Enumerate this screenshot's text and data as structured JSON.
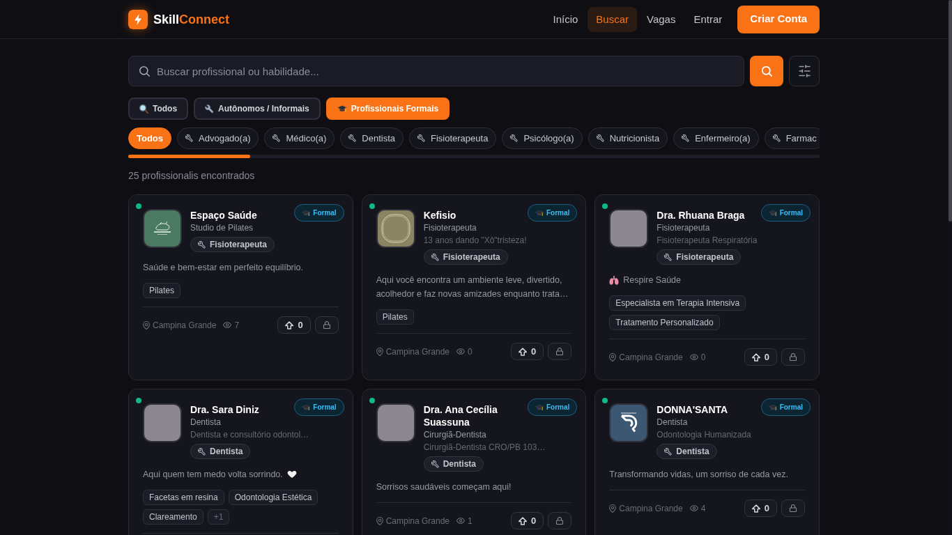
{
  "header": {
    "logo": {
      "text": "Skill",
      "accent": "Connect"
    },
    "nav": [
      {
        "label": "Início",
        "selected": false
      },
      {
        "label": "Buscar",
        "selected": true
      },
      {
        "label": "Vagas",
        "selected": false
      },
      {
        "label": "Entrar",
        "selected": false
      }
    ],
    "cta": "Criar Conta"
  },
  "search": {
    "placeholder": "Buscar profissional ou habilidade..."
  },
  "type_tabs": [
    {
      "kind": "all",
      "label": "Todos",
      "selected": false
    },
    {
      "kind": "informal",
      "label": "Autônomos / Informais",
      "selected": false
    },
    {
      "kind": "formal",
      "label": "Profissionais Formais",
      "selected": true
    }
  ],
  "category_chips": [
    {
      "kind": "all",
      "label": "Todos",
      "selected": true
    },
    {
      "kind": "category",
      "label": "Advogado(a)",
      "selected": false
    },
    {
      "kind": "category",
      "label": "Médico(a)",
      "selected": false
    },
    {
      "kind": "category",
      "label": "Dentista",
      "selected": false
    },
    {
      "kind": "category",
      "label": "Fisioterapeuta",
      "selected": false
    },
    {
      "kind": "category",
      "label": "Psicólogo(a)",
      "selected": false
    },
    {
      "kind": "category",
      "label": "Nutricionista",
      "selected": false
    },
    {
      "kind": "category",
      "label": "Enfermeiro(a)",
      "selected": false
    },
    {
      "kind": "category",
      "label": "Farmac",
      "selected": false
    }
  ],
  "results_count": "25 profissionalis encontrados",
  "cards": [
    {
      "online": true,
      "avatar": {
        "kind": "sketch"
      },
      "badge": "Formal",
      "name": "Espaço Saúde",
      "lines": [
        "Studio de Pilates"
      ],
      "category": "Fisioterapeuta",
      "description": {
        "kind": "plain",
        "text": "Saúde e bem-estar em perfeito equilíbrio."
      },
      "tags": [
        "Pilates"
      ],
      "footer": {
        "location": "Campina Grande",
        "views": "7",
        "votes": "0"
      }
    },
    {
      "online": true,
      "avatar": {
        "kind": "rings"
      },
      "badge": "Formal",
      "name": "Kefisio",
      "lines": [
        "Fisioterapeuta",
        "13 anos dando \"Xô\"tristeza!"
      ],
      "category": "Fisioterapeuta",
      "description": {
        "kind": "plain",
        "text": "Aqui você encontra um ambiente leve, divertido, acolhedor e faz novas amizades enquanto trata…"
      },
      "tags": [
        "Pilates"
      ],
      "footer": {
        "location": "Campina Grande",
        "views": "0",
        "votes": "0"
      }
    },
    {
      "online": true,
      "avatar": {
        "kind": "photo"
      },
      "badge": "Formal",
      "name": "Dra. Rhuana Braga",
      "lines": [
        "Fisioterapeuta",
        "Fisioterapeuta Respiratória"
      ],
      "category": "Fisioterapeuta",
      "description": {
        "kind": "lungs",
        "text": "Respire Saúde"
      },
      "tags": [
        "Especialista em Terapia Intensiva",
        "Tratamento Personalizado"
      ],
      "footer": {
        "location": "Campina Grande",
        "views": "0",
        "votes": "0"
      }
    },
    {
      "online": true,
      "avatar": {
        "kind": "photo"
      },
      "badge": "Formal",
      "name": "Dra. Sara Diniz",
      "lines": [
        "Dentista",
        "Dentista e consultório odontol…"
      ],
      "category": "Dentista",
      "description": {
        "kind": "heart",
        "text": "Aqui quem tem medo volta sorrindo."
      },
      "tags": [
        "Facetas em resina",
        "Odontologia Estética",
        "Clareamento"
      ],
      "more_tags": "+1"
    },
    {
      "online": true,
      "avatar": {
        "kind": "photo"
      },
      "badge": "Formal",
      "name": "Dra. Ana Cecília Suassuna",
      "lines": [
        "Cirurgiã-Dentista",
        "Cirurgiã-Dentista CRO/PB 103…"
      ],
      "category": "Dentista",
      "description": {
        "kind": "plain",
        "text": "Sorrisos saudáveis começam aqui!"
      },
      "footer": {
        "location": "Campina Grande",
        "views": "1",
        "votes": "0"
      }
    },
    {
      "online": true,
      "avatar": {
        "kind": "swirl"
      },
      "badge": "Formal",
      "name": "DONNA'SANTA",
      "lines": [
        "Dentista",
        "Odontologia Humanizada"
      ],
      "category": "Dentista",
      "description": {
        "kind": "plain",
        "text": "Transformando vidas, um sorriso de cada vez."
      },
      "footer": {
        "location": "Campina Grande",
        "views": "4",
        "votes": "0"
      }
    }
  ]
}
